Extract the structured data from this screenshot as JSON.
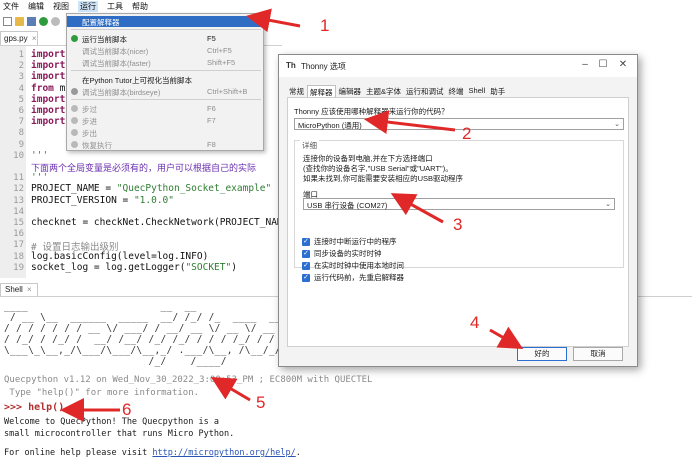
{
  "menubar": {
    "items": [
      "文件",
      "编辑",
      "视图",
      "运行",
      "工具",
      "帮助"
    ]
  },
  "editor": {
    "tab_label": "gps.py",
    "tab_close": "×",
    "lines": [
      {
        "no": "1",
        "segments": [
          {
            "t": "import",
            "c": "kw"
          }
        ]
      },
      {
        "no": "2",
        "segments": [
          {
            "t": "import",
            "c": "kw"
          }
        ]
      },
      {
        "no": "3",
        "segments": [
          {
            "t": "import",
            "c": "kw"
          }
        ]
      },
      {
        "no": "4",
        "segments": [
          {
            "t": "from",
            "c": "kw"
          },
          {
            "t": " ma",
            "c": ""
          }
        ]
      },
      {
        "no": "5",
        "segments": [
          {
            "t": "import",
            "c": "kw"
          }
        ]
      },
      {
        "no": "6",
        "segments": [
          {
            "t": "import",
            "c": "kw"
          }
        ]
      },
      {
        "no": "7",
        "segments": [
          {
            "t": "import",
            "c": "kw"
          }
        ]
      },
      {
        "no": "8",
        "segments": []
      },
      {
        "no": "9",
        "segments": []
      },
      {
        "no": "10",
        "segments": [
          {
            "t": "'''",
            "c": "str"
          }
        ]
      },
      {
        "no": "",
        "segments": [
          {
            "t": "下面两个全局变量是必须有的，用户可以根据自己的实际",
            "c": "cn"
          }
        ]
      },
      {
        "no": "11",
        "segments": [
          {
            "t": "'''",
            "c": "str"
          }
        ]
      },
      {
        "no": "12",
        "segments": [
          {
            "t": "PROJECT_NAME = ",
            "c": ""
          },
          {
            "t": "\"QuecPython_Socket_example\"",
            "c": "str"
          }
        ]
      },
      {
        "no": "13",
        "segments": [
          {
            "t": "PROJECT_VERSION = ",
            "c": ""
          },
          {
            "t": "\"1.0.0\"",
            "c": "str"
          }
        ]
      },
      {
        "no": "14",
        "segments": []
      },
      {
        "no": "15",
        "segments": [
          {
            "t": "checknet = checkNet.CheckNetwork(PROJECT_NAME,",
            "c": ""
          }
        ]
      },
      {
        "no": "16",
        "segments": []
      },
      {
        "no": "17",
        "segments": [
          {
            "t": "# 设置日志输出级别",
            "c": "cmt"
          }
        ]
      },
      {
        "no": "18",
        "segments": [
          {
            "t": "log.basicConfig(level=log.INFO)",
            "c": ""
          }
        ]
      },
      {
        "no": "19",
        "segments": [
          {
            "t": "socket_log = log.getLogger(",
            "c": ""
          },
          {
            "t": "\"SOCKET\"",
            "c": "str"
          },
          {
            "t": ")",
            "c": ""
          }
        ]
      }
    ]
  },
  "run_menu": {
    "items": [
      {
        "label": "配置解释器",
        "shortcut": "",
        "state": "highlight",
        "icon": ""
      },
      {
        "label": "运行当前脚本",
        "shortcut": "F5",
        "state": "enabled",
        "icon": "#2e9b3c"
      },
      {
        "label": "调试当前脚本(nicer)",
        "shortcut": "Ctrl+F5",
        "state": "disabled",
        "icon": ""
      },
      {
        "label": "调试当前脚本(faster)",
        "shortcut": "Shift+F5",
        "state": "disabled",
        "icon": ""
      },
      {
        "label": "在Python Tutor上可视化当前脚本",
        "shortcut": "",
        "state": "enabled",
        "icon": ""
      },
      {
        "label": "调试当前脚本(birdseye)",
        "shortcut": "Ctrl+Shift+B",
        "state": "disabled",
        "icon": "#9a9a9a"
      },
      {
        "label": "步过",
        "shortcut": "F6",
        "state": "disabled",
        "icon": "#b9b9b9"
      },
      {
        "label": "步进",
        "shortcut": "F7",
        "state": "disabled",
        "icon": "#b9b9b9"
      },
      {
        "label": "步出",
        "shortcut": "",
        "state": "disabled",
        "icon": "#b9b9b9"
      },
      {
        "label": "恢复执行",
        "shortcut": "F8",
        "state": "disabled",
        "icon": "#b9b9b9"
      }
    ]
  },
  "dialog": {
    "title": "Thonny 选项",
    "logo": "Th",
    "tabs": [
      "常规",
      "解释器",
      "编辑器",
      "主题&字体",
      "运行和调试",
      "终端",
      "Shell",
      "助手"
    ],
    "selected_tab": "解释器",
    "interpreter_question": "Thonny 应该使用哪种解释器来运行你的代码？",
    "interpreter_value": "MicroPython (通用)",
    "detail_heading": "详细",
    "detail_lines": [
      "连接你的设备到电脑,并在下方选择端口",
      "(查找你的设备名字,\"USB Serial\"或\"UART\")。",
      "如果未找到,你可能需要安装相应的USB驱动程序"
    ],
    "port_label": "端口",
    "port_value": "USB 串行设备 (COM27)",
    "checkboxes": [
      "连接时中断运行中的程序",
      "同步设备的实时时钟",
      "在实时时钟中使用本地时间",
      "运行代码前，先重启解释器"
    ],
    "ok_label": "好的",
    "cancel_label": "取消",
    "win_minimize": "–",
    "win_maximize": "☐",
    "win_close": "✕"
  },
  "shell": {
    "tab_label": "Shell",
    "tab_close": "×",
    "ascii_art": [
      "____                      __  __",
      " / __ \\__  ______  _____  __/ /_/ /_  ____  ____",
      "/ / / / / / / __ \\/ ___/ / __/ __ \\/ __ \\/ __ \\",
      "/ /_/ / /_/ /  __/ /__/ /_/ /_/ / / / /_/ / / / /",
      "\\___\\_\\__,_/\\___/\\___/\\__,_/ .___/\\__, /\\__/_/ /_/",
      "                        /_/    /____/"
    ],
    "version_line": "Quecpython v1.12 on Wed_Nov_30_2022_3:00:53_PM ; EC800M with QUECTEL",
    "hint_line": " Type \"help()\" for more information.",
    "prompt": ">>> ",
    "command": "help()",
    "welcome": [
      "Welcome to QuecPython! The Quecpython is a",
      "small microcontroller that runs Micro Python."
    ],
    "online_help_prefix": "For online help please visit ",
    "online_help_link": "http://micropython.org/help/",
    "online_help_suffix": "."
  },
  "annotations": [
    "1",
    "2",
    "3",
    "4",
    "5",
    "6"
  ],
  "colors": {
    "annotation": "#e02828",
    "menu_highlight": "#2f6dc4",
    "checkbox": "#2a6fd1"
  }
}
